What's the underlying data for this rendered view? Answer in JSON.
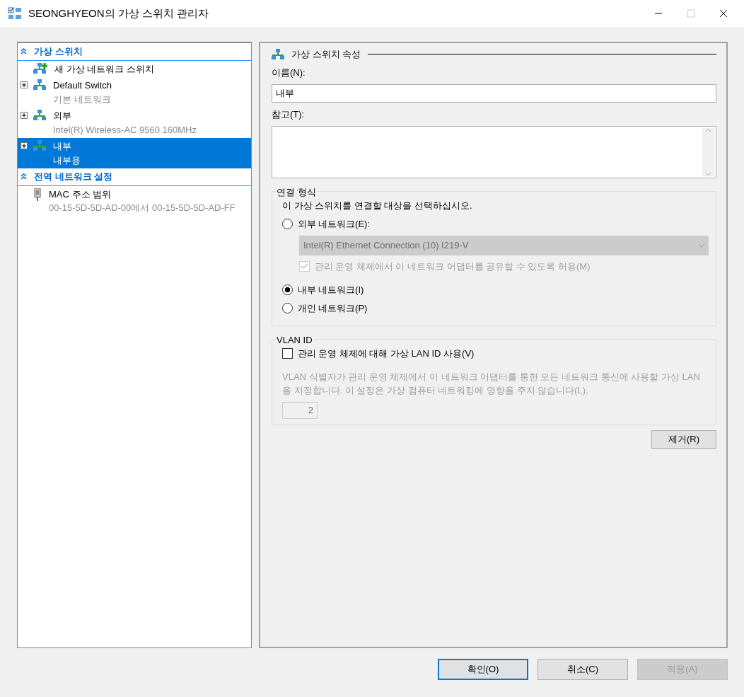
{
  "window": {
    "title": "SEONGHYEON의 가상 스위치 관리자",
    "maximize_disabled": true
  },
  "sidebar": {
    "sections": [
      {
        "title": "가상 스위치",
        "expanded": true,
        "items": [
          {
            "kind": "action",
            "label": "새 가상 네트워크 스위치",
            "selected": false
          },
          {
            "kind": "switch",
            "label": "Default Switch",
            "sub": "기본 네트워크",
            "selected": false
          },
          {
            "kind": "switch",
            "label": "외부",
            "sub": "Intel(R) Wireless-AC 9560 160MHz",
            "selected": false
          },
          {
            "kind": "switch",
            "label": "내부",
            "sub": "내부용",
            "selected": true
          }
        ]
      },
      {
        "title": "전역 네트워크 설정",
        "expanded": true,
        "items": [
          {
            "kind": "setting",
            "label": "MAC 주소 범위",
            "sub": "00-15-5D-5D-AD-00에서 00-15-5D-5D-AD-FF",
            "selected": false
          }
        ]
      }
    ]
  },
  "properties": {
    "heading": "가상 스위치 속성",
    "name_label": "이름(N):",
    "name_value": "내부",
    "notes_label": "참고(T):",
    "connection": {
      "legend": "연결 형식",
      "prompt": "이 가상 스위치를 연결할 대상을 선택하십시오.",
      "options": [
        {
          "label": "외부 네트워크(E):",
          "selected": false,
          "adapter": {
            "value": "Intel(R) Ethernet Connection (10) I219-V",
            "disabled": true
          },
          "share": {
            "label": "관리 운영 체제에서 이 네트워크 어댑터를 공유할 수 있도록 허용(M)",
            "checked": true,
            "disabled": true
          }
        },
        {
          "label": "내부 네트워크(I)",
          "selected": true
        },
        {
          "label": "개인 네트워크(P)",
          "selected": false
        }
      ]
    },
    "vlan": {
      "legend": "VLAN ID",
      "checkbox": {
        "label": "관리 운영 체제에 대해 가상 LAN ID 사용(V)",
        "checked": false
      },
      "description": "VLAN 식별자가 관리 운영 체제에서 이 네트워크 어댑터를 통한 모든 네트워크 통신에 사용할 가상 LAN을 지정합니다. 이 설정은 가상 컴퓨터 네트워킹에 영향을 주지 않습니다(L).",
      "id_value": "2",
      "disabled": true
    },
    "remove_button": "제거(R)"
  },
  "buttons": [
    {
      "label": "확인(O)",
      "kind": "default",
      "disabled": false
    },
    {
      "label": "취소(C)",
      "kind": "normal",
      "disabled": false
    },
    {
      "label": "적용(A)",
      "kind": "normal",
      "disabled": true
    }
  ]
}
